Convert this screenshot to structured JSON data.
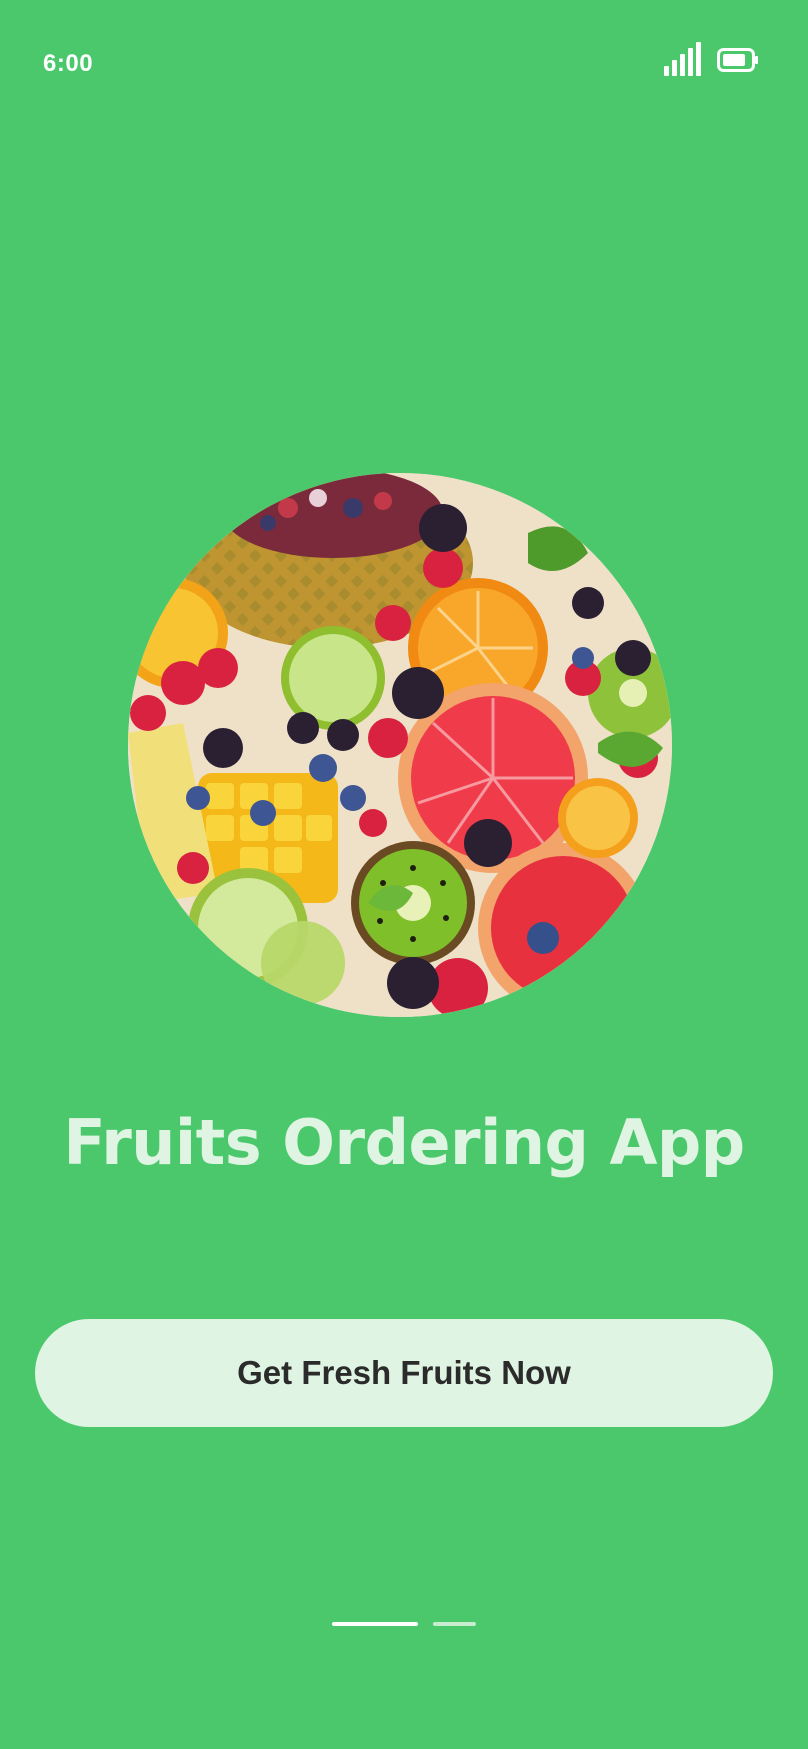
{
  "status_bar": {
    "time": "6:00",
    "signal_icon": "signal-bars-icon",
    "battery_icon": "battery-icon"
  },
  "hero_image": {
    "alt": "Platter of fresh cut fruits"
  },
  "title": "Fruits Ordering App",
  "cta": {
    "label": "Get Fresh Fruits Now"
  },
  "pager": {
    "pages": 2,
    "active_index": 0
  },
  "colors": {
    "background": "#4cc86c",
    "title": "#dff4e2",
    "button_bg": "#dff4e2",
    "button_text": "#2b2b2b"
  }
}
